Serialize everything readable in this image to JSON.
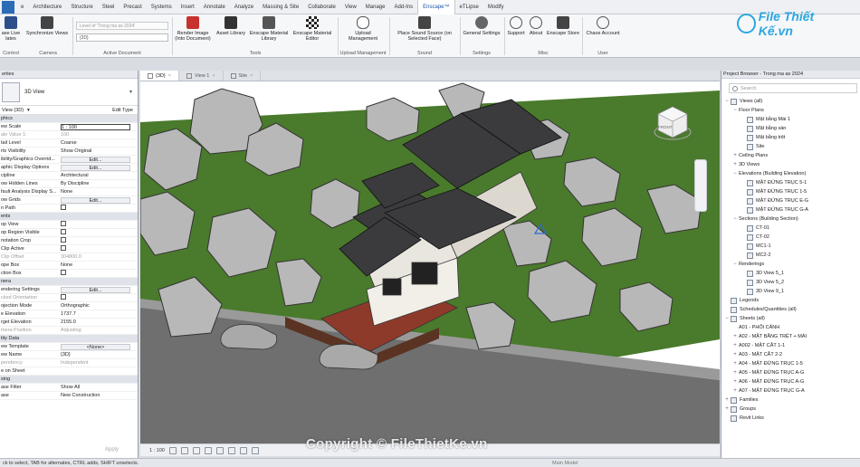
{
  "ribbon_tabs": [
    "e",
    "Architecture",
    "Structure",
    "Steel",
    "Precast",
    "Systems",
    "Insert",
    "Annotate",
    "Analyze",
    "Massing & Site",
    "Collaborate",
    "View",
    "Manage",
    "Add-Ins",
    "Enscape™",
    "eTLipse",
    "Modify"
  ],
  "active_tab": "Enscape™",
  "ribbon_buttons": {
    "live_updates": "ase Live\nlates",
    "sync_views": "Synchronize Views",
    "render_image": "Render Image\n(Into Document)",
    "asset_library": "Asset Library",
    "material_library": "Enscape Material\nLibrary",
    "material_editor": "Enscape Material\nEditor",
    "upload_management": "Upload\nManagement",
    "sound_source": "Place Sound Source (on\nSelected Face)",
    "general_settings": "General Settings",
    "support": "Support",
    "about": "About",
    "enscape_store": "Enscape Store",
    "chaos_account": "Chaos Account"
  },
  "ribbon_groups": {
    "control": "Control",
    "camera": "Camera",
    "active_document": "Active Document",
    "tools": "Tools",
    "upload": "Upload Management",
    "sound": "Sound",
    "settings": "Settings",
    "misc": "Misc",
    "user": "User"
  },
  "active_document": {
    "search_text": "Level of 'Trong ma as 2024'",
    "value": "{3D}"
  },
  "logo_text": "File Thiết Kế.vn",
  "properties": {
    "title": "erties",
    "type_name": "3D View",
    "view_selector": "View (3D)",
    "edit_type": "Edit Type",
    "rows": [
      {
        "k": "phics",
        "v": "",
        "kind": "section"
      },
      {
        "k": "ew Scale",
        "v": "1 : 100",
        "kind": "box"
      },
      {
        "k": "ale Value   1:",
        "v": "100",
        "kind": "muted"
      },
      {
        "k": "tail Level",
        "v": "Coarse",
        "kind": "text"
      },
      {
        "k": "rts Visibility",
        "v": "Show Original",
        "kind": "text"
      },
      {
        "k": "ibility/Graphics Overrid...",
        "v": "Edit...",
        "kind": "btn"
      },
      {
        "k": "aphic Display Options",
        "v": "Edit...",
        "kind": "btn"
      },
      {
        "k": "cipline",
        "v": "Architectural",
        "kind": "text"
      },
      {
        "k": "ow Hidden Lines",
        "v": "By Discipline",
        "kind": "text"
      },
      {
        "k": "fault Analysis Display S...",
        "v": "None",
        "kind": "text"
      },
      {
        "k": "ow Grids",
        "v": "Edit...",
        "kind": "btn"
      },
      {
        "k": "n Path",
        "v": "",
        "kind": "check"
      },
      {
        "k": "ents",
        "v": "",
        "kind": "section"
      },
      {
        "k": "op View",
        "v": "",
        "kind": "check"
      },
      {
        "k": "op Region Visible",
        "v": "",
        "kind": "check"
      },
      {
        "k": "notation Crop",
        "v": "",
        "kind": "check"
      },
      {
        "k": "Clip Active",
        "v": "",
        "kind": "check"
      },
      {
        "k": "Clip Offset",
        "v": "304800.0",
        "kind": "muted"
      },
      {
        "k": "ope Box",
        "v": "None",
        "kind": "text"
      },
      {
        "k": "ction Box",
        "v": "",
        "kind": "check"
      },
      {
        "k": "nera",
        "v": "",
        "kind": "section"
      },
      {
        "k": "endering Settings",
        "v": "Edit...",
        "kind": "btn"
      },
      {
        "k": "cked Orientation",
        "v": "",
        "kind": "mutedcheck"
      },
      {
        "k": "ojection Mode",
        "v": "Orthographic",
        "kind": "text"
      },
      {
        "k": "e Elevation",
        "v": "1737.7",
        "kind": "text"
      },
      {
        "k": "rget Elevation",
        "v": "2155.0",
        "kind": "text"
      },
      {
        "k": "mera Position",
        "v": "Adjusting",
        "kind": "muted"
      },
      {
        "k": "tity Data",
        "v": "",
        "kind": "section"
      },
      {
        "k": "ew Template",
        "v": "<None>",
        "kind": "btn"
      },
      {
        "k": "ew Name",
        "v": "{3D}",
        "kind": "text"
      },
      {
        "k": "pendency",
        "v": "Independent",
        "kind": "muted"
      },
      {
        "k": "e on Sheet",
        "v": "",
        "kind": "text"
      },
      {
        "k": "sing",
        "v": "",
        "kind": "section"
      },
      {
        "k": "ase Filter",
        "v": "Show All",
        "kind": "text"
      },
      {
        "k": "ase",
        "v": "New Construction",
        "kind": "text"
      }
    ],
    "apply": "Apply"
  },
  "view_tabs": [
    {
      "label": "{3D}",
      "active": true
    },
    {
      "label": "View 1",
      "active": false
    },
    {
      "label": "Site",
      "active": false
    }
  ],
  "viewcube_label": "FRONT",
  "view_control": {
    "scale": "1 : 100"
  },
  "project_browser": {
    "title": "Project Browser - Trong ma as 2024",
    "search_placeholder": "Search",
    "items": [
      {
        "label": "Views (all)",
        "level": 0,
        "toggle": "−",
        "icon": true
      },
      {
        "label": "Floor Plans",
        "level": 1,
        "toggle": "−",
        "icon": false
      },
      {
        "label": "Mặt bằng Mái 1",
        "level": 2,
        "toggle": "",
        "icon": true
      },
      {
        "label": "Mặt bằng sàn",
        "level": 2,
        "toggle": "",
        "icon": true
      },
      {
        "label": "Mặt bằng trệt",
        "level": 2,
        "toggle": "",
        "icon": true
      },
      {
        "label": "Site",
        "level": 2,
        "toggle": "",
        "icon": true
      },
      {
        "label": "Ceiling Plans",
        "level": 1,
        "toggle": "+",
        "icon": false
      },
      {
        "label": "3D Views",
        "level": 1,
        "toggle": "+",
        "icon": false
      },
      {
        "label": "Elevations (Building Elevation)",
        "level": 1,
        "toggle": "−",
        "icon": false
      },
      {
        "label": "MẶT ĐỨNG TRỤC 5-1",
        "level": 2,
        "toggle": "",
        "icon": true
      },
      {
        "label": "MẶT ĐỨNG TRỤC 1-5",
        "level": 2,
        "toggle": "",
        "icon": true
      },
      {
        "label": "MẶT ĐỨNG TRỤC E-G",
        "level": 2,
        "toggle": "",
        "icon": true
      },
      {
        "label": "MẶT ĐỨNG TRỤC G-A",
        "level": 2,
        "toggle": "",
        "icon": true
      },
      {
        "label": "Sections (Building Section)",
        "level": 1,
        "toggle": "−",
        "icon": false
      },
      {
        "label": "CT-01",
        "level": 2,
        "toggle": "",
        "icon": true
      },
      {
        "label": "CT-02",
        "level": 2,
        "toggle": "",
        "icon": true
      },
      {
        "label": "MC1-1",
        "level": 2,
        "toggle": "",
        "icon": true
      },
      {
        "label": "MC2-2",
        "level": 2,
        "toggle": "",
        "icon": true
      },
      {
        "label": "Renderings",
        "level": 1,
        "toggle": "−",
        "icon": false
      },
      {
        "label": "3D View 5_1",
        "level": 2,
        "toggle": "",
        "icon": true
      },
      {
        "label": "3D View 5_2",
        "level": 2,
        "toggle": "",
        "icon": true
      },
      {
        "label": "3D View 9_1",
        "level": 2,
        "toggle": "",
        "icon": true
      },
      {
        "label": "Legends",
        "level": 0,
        "toggle": "",
        "icon": true
      },
      {
        "label": "Schedules/Quantities (all)",
        "level": 0,
        "toggle": "",
        "icon": true
      },
      {
        "label": "Sheets (all)",
        "level": 0,
        "toggle": "−",
        "icon": true
      },
      {
        "label": "A01 - PHỐI CẢNH",
        "level": 1,
        "toggle": "",
        "icon": false
      },
      {
        "label": "A02 - MẶT BẰNG TRỆT + MÁI",
        "level": 1,
        "toggle": "+",
        "icon": false
      },
      {
        "label": "A002 - MẶT CẮT 1-1",
        "level": 1,
        "toggle": "+",
        "icon": false
      },
      {
        "label": "A03 - MẶT CẮT 2-2",
        "level": 1,
        "toggle": "+",
        "icon": false
      },
      {
        "label": "A04 - MẶT ĐỨNG TRỤC 1-5",
        "level": 1,
        "toggle": "+",
        "icon": false
      },
      {
        "label": "A05 - MẶT ĐỨNG TRỤC A-G",
        "level": 1,
        "toggle": "+",
        "icon": false
      },
      {
        "label": "A06 - MẶT ĐỨNG TRỤC A-G",
        "level": 1,
        "toggle": "+",
        "icon": false
      },
      {
        "label": "A07 - MẶT ĐỨNG TRỤC G-A",
        "level": 1,
        "toggle": "+",
        "icon": false
      },
      {
        "label": "Families",
        "level": 0,
        "toggle": "+",
        "icon": true
      },
      {
        "label": "Groups",
        "level": 0,
        "toggle": "+",
        "icon": true
      },
      {
        "label": "Revit Links",
        "level": 0,
        "toggle": "",
        "icon": true
      }
    ]
  },
  "status_bar": {
    "hint": "ck to select, TAB for alternates, CTRL adds, SHIFT unselects.",
    "model": "Main Model"
  },
  "copyright": "Copyright © FileThietKe.vn",
  "colors": {
    "grass": "#4a7a2c",
    "road": "#6e6e6e",
    "roof": "#3b3b3e",
    "brick": "#8e3a2a",
    "accent": "#2b6cb6",
    "logo": "#2ba8e0"
  }
}
